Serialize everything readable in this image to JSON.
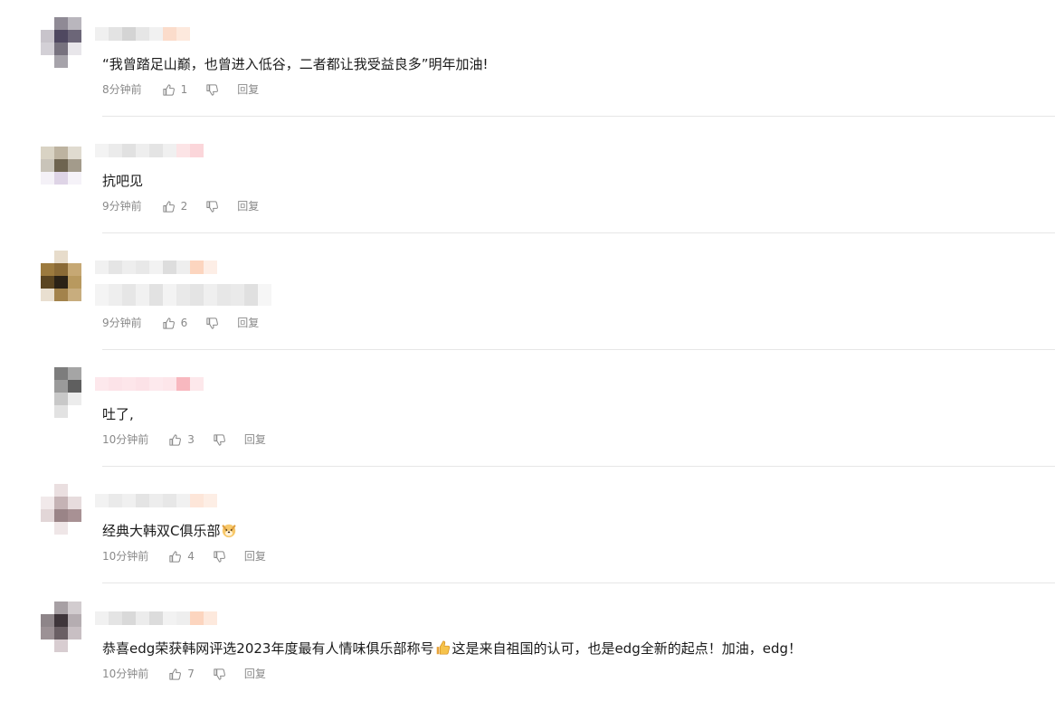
{
  "comments": [
    {
      "text": "“我曾踏足山巅，也曾进入低谷，二者都让我受益良多”明年加油!",
      "time": "8分钟前",
      "likes": "1",
      "reply": "回复"
    },
    {
      "text": "抗吧见",
      "time": "9分钟前",
      "likes": "2",
      "reply": "回复"
    },
    {
      "text": "",
      "time": "9分钟前",
      "likes": "6",
      "reply": "回复"
    },
    {
      "text": "吐了,",
      "time": "10分钟前",
      "likes": "3",
      "reply": "回复"
    },
    {
      "text": "经典大韩双C俱乐部",
      "emoji": "dog-face-emoji",
      "time": "10分钟前",
      "likes": "4",
      "reply": "回复"
    },
    {
      "text_before": "恭喜edg荣获韩网评选2023年度最有人情味俱乐部称号",
      "emoji": "thumbs-up-emoji",
      "text_after": "这是来自祖国的认可，也是edg全新的起点！加油，edg！",
      "time": "10分钟前",
      "likes": "7",
      "reply": "回复"
    }
  ],
  "icons": {
    "like": "thumbs-up-outline-icon",
    "dislike": "thumbs-down-outline-icon"
  },
  "colors": {
    "meta_text": "#8a8a8a",
    "divider": "#e6e6e6",
    "body_text": "#1a1a1a"
  }
}
